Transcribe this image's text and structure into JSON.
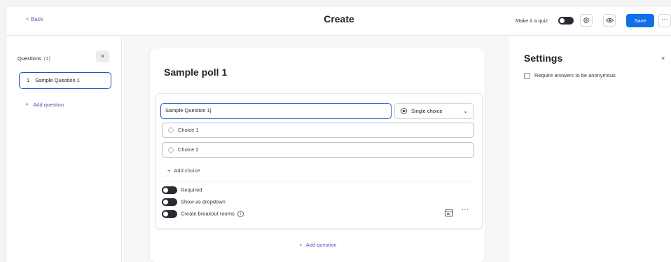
{
  "topbar": {
    "back_label": "< Back",
    "title": "Create",
    "quiz_label": "Make it a quiz",
    "save_label": "Save",
    "more_label": "⋯"
  },
  "sidebar": {
    "header": "Questions",
    "count": "(1)",
    "close_label": "×",
    "items": [
      {
        "number": "1",
        "label": "Sample Question 1"
      }
    ],
    "add_question_label": "Add question"
  },
  "editor": {
    "poll_title": "Sample poll 1",
    "question_value": "Sample Question 1|",
    "question_type": "Single choice",
    "choices": [
      {
        "label": "Choice 1"
      },
      {
        "label": "Choice 2"
      }
    ],
    "add_choice_label": "Add choice",
    "options": {
      "required": "Required",
      "dropdown": "Show as dropdown",
      "breakout": "Create breakout rooms"
    },
    "add_question_label": "Add question",
    "more_label": "⋯"
  },
  "settings": {
    "title": "Settings",
    "close_label": "×",
    "anonymous_label": "Require answers to be anonymous"
  },
  "colors": {
    "accent": "#0e6fea",
    "focus": "#1a56c9",
    "link": "#4a55b5"
  },
  "icons": [
    "gear-icon",
    "eye-icon",
    "info-icon",
    "question-bank-icon"
  ]
}
